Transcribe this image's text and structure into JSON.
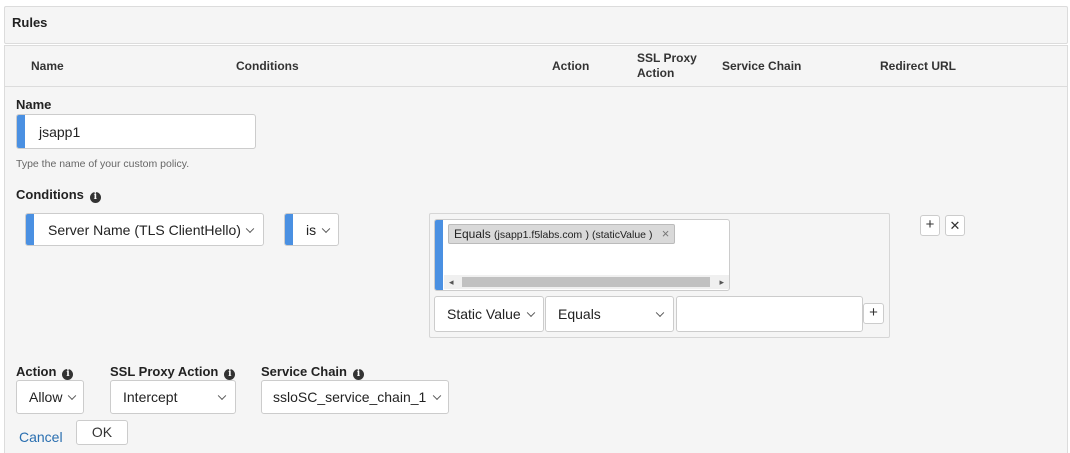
{
  "panel": {
    "title": "Rules"
  },
  "table_headers": {
    "name": "Name",
    "conditions": "Conditions",
    "action": "Action",
    "ssl_proxy_action_line1": "SSL Proxy",
    "ssl_proxy_action_line2": "Action",
    "service_chain": "Service Chain",
    "redirect_url": "Redirect URL"
  },
  "form": {
    "name_label": "Name",
    "name_value": "jsapp1",
    "name_hint": "Type the name of your custom policy.",
    "conditions_label": "Conditions",
    "condition": {
      "field": "Server Name (TLS ClientHello)",
      "operator": "is",
      "tag": {
        "op": "Equals",
        "value": "(jsapp1.f5labs.com",
        "type": ") (staticValue )"
      },
      "value_type": "Static Value",
      "match": "Equals",
      "value_input": ""
    },
    "action_label": "Action",
    "action_value": "Allow",
    "ssl_proxy_label": "SSL Proxy Action",
    "ssl_proxy_value": "Intercept",
    "service_chain_label": "Service Chain",
    "service_chain_value": "ssloSC_service_chain_1",
    "cancel_label": "Cancel",
    "ok_label": "OK"
  },
  "icons": {
    "info": "info-icon",
    "chevron": "chevron-down-icon",
    "plus": "plus-icon",
    "close": "close-icon"
  },
  "colors": {
    "required_bar": "#4a90e2",
    "link": "#2a6fb0",
    "panel_bg": "#f5f5f5"
  }
}
